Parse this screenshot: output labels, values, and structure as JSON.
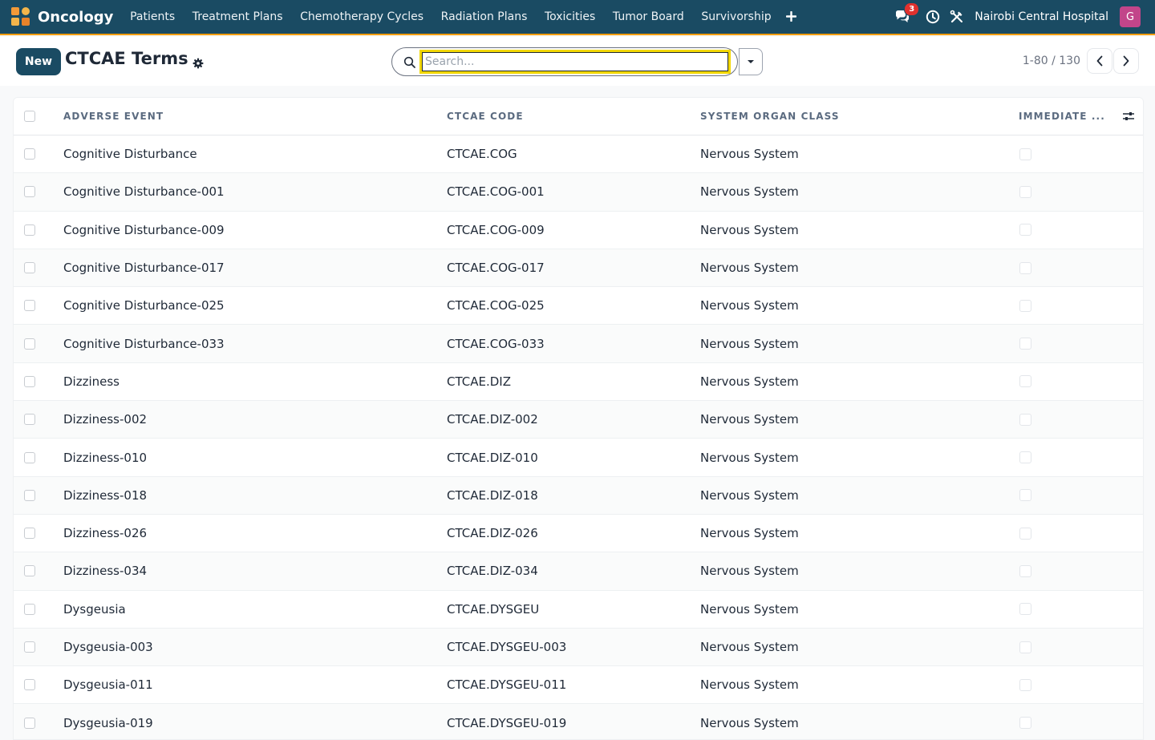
{
  "navbar": {
    "app_name": "Oncology",
    "menu": [
      {
        "label": "Patients"
      },
      {
        "label": "Treatment Plans"
      },
      {
        "label": "Chemotherapy Cycles"
      },
      {
        "label": "Radiation Plans"
      },
      {
        "label": "Toxicities"
      },
      {
        "label": "Tumor Board"
      },
      {
        "label": "Survivorship"
      }
    ],
    "plus": "+",
    "chat_badge": "3",
    "company": "Nairobi Central Hospital",
    "avatar_initial": "G",
    "icons": [
      "app-logo-icon",
      "chat-icon",
      "clock-icon",
      "tools-icon",
      "plus-icon"
    ]
  },
  "control": {
    "new_label": "New",
    "title": "CTCAE Terms",
    "search_placeholder": "Search...",
    "search_value": "",
    "pager": "1-80 / 130"
  },
  "list": {
    "columns": [
      "ADVERSE EVENT",
      "CTCAE CODE",
      "SYSTEM ORGAN CLASS",
      "IMMEDIATE ..."
    ],
    "rows": [
      {
        "event": "Cognitive Disturbance",
        "code": "CTCAE.COG",
        "soc": "Nervous System",
        "immediate": false
      },
      {
        "event": "Cognitive Disturbance-001",
        "code": "CTCAE.COG-001",
        "soc": "Nervous System",
        "immediate": false
      },
      {
        "event": "Cognitive Disturbance-009",
        "code": "CTCAE.COG-009",
        "soc": "Nervous System",
        "immediate": false
      },
      {
        "event": "Cognitive Disturbance-017",
        "code": "CTCAE.COG-017",
        "soc": "Nervous System",
        "immediate": false
      },
      {
        "event": "Cognitive Disturbance-025",
        "code": "CTCAE.COG-025",
        "soc": "Nervous System",
        "immediate": false
      },
      {
        "event": "Cognitive Disturbance-033",
        "code": "CTCAE.COG-033",
        "soc": "Nervous System",
        "immediate": false
      },
      {
        "event": "Dizziness",
        "code": "CTCAE.DIZ",
        "soc": "Nervous System",
        "immediate": false
      },
      {
        "event": "Dizziness-002",
        "code": "CTCAE.DIZ-002",
        "soc": "Nervous System",
        "immediate": false
      },
      {
        "event": "Dizziness-010",
        "code": "CTCAE.DIZ-010",
        "soc": "Nervous System",
        "immediate": false
      },
      {
        "event": "Dizziness-018",
        "code": "CTCAE.DIZ-018",
        "soc": "Nervous System",
        "immediate": false
      },
      {
        "event": "Dizziness-026",
        "code": "CTCAE.DIZ-026",
        "soc": "Nervous System",
        "immediate": false
      },
      {
        "event": "Dizziness-034",
        "code": "CTCAE.DIZ-034",
        "soc": "Nervous System",
        "immediate": false
      },
      {
        "event": "Dysgeusia",
        "code": "CTCAE.DYSGEU",
        "soc": "Nervous System",
        "immediate": false
      },
      {
        "event": "Dysgeusia-003",
        "code": "CTCAE.DYSGEU-003",
        "soc": "Nervous System",
        "immediate": false
      },
      {
        "event": "Dysgeusia-011",
        "code": "CTCAE.DYSGEU-011",
        "soc": "Nervous System",
        "immediate": false
      },
      {
        "event": "Dysgeusia-019",
        "code": "CTCAE.DYSGEU-019",
        "soc": "Nervous System",
        "immediate": false
      }
    ]
  },
  "colors": {
    "navbar_bg": "#1a4b63",
    "navbar_accent": "#f59e0b",
    "primary_button": "#1a4b63",
    "badge": "#e0312e",
    "avatar": "#c2458a",
    "focus_ring": "#f2d700"
  }
}
